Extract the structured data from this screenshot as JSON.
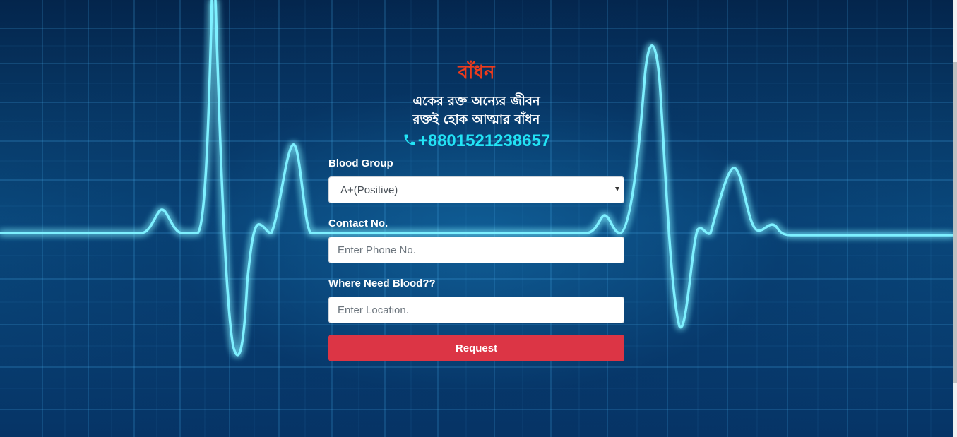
{
  "brand": {
    "title": "বাঁধন"
  },
  "tagline": {
    "line1": "একের রক্ত অন্যের জীবন",
    "line2": "রক্তই হোক আত্মার বাঁধন"
  },
  "contact": {
    "phone": "+8801521238657",
    "icon": "phone-icon"
  },
  "form": {
    "blood_group_label": "Blood Group",
    "blood_group_value": "A+(Positive)",
    "contact_label": "Contact No.",
    "contact_placeholder": "Enter Phone No.",
    "location_label": "Where Need Blood??",
    "location_placeholder": "Enter Location.",
    "submit_label": "Request"
  },
  "colors": {
    "brand": "#ee3b1c",
    "phone": "#22e3f5",
    "button": "#dc3545",
    "background": "#062a52"
  }
}
